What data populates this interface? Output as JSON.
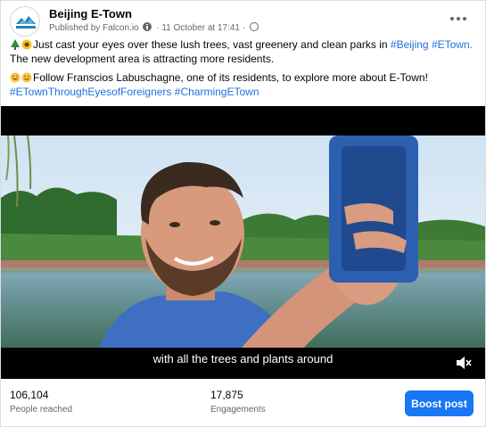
{
  "post": {
    "page_name": "Beijing E-Town",
    "published_by": "Published by Falcon.io",
    "dot": "·",
    "date": "11 October at 17:41",
    "more_icon": "more-horizontal-icon"
  },
  "caption": {
    "line1_text": "Just cast your eyes over these lush trees, vast greenery and clean parks in",
    "line1_tags": [
      "#Beijing",
      "#ETown."
    ],
    "line2_text": "The new development area is attracting more residents.",
    "line3_text": "Follow Franscios Labuschagne, one of its residents, to explore more about E-Town!",
    "line4_tags": [
      "#ETownThroughEyesofForeigners",
      "#CharmingETown"
    ],
    "emoji_line1": [
      "tree-emoji",
      "sunflower-emoji"
    ],
    "emoji_line3": [
      "grinning-sweat-emoji",
      "smile-emoji"
    ]
  },
  "video": {
    "subtitle": "with all the trees and plants around",
    "mute_icon": "speaker-muted-icon"
  },
  "stats": {
    "reached_value": "106,104",
    "reached_label": "People reached",
    "engagements_value": "17,875",
    "engagements_label": "Engagements"
  },
  "actions": {
    "boost_label": "Boost post"
  },
  "colors": {
    "link": "#216fdb",
    "boost": "#1877f2",
    "meta": "#65676b"
  }
}
